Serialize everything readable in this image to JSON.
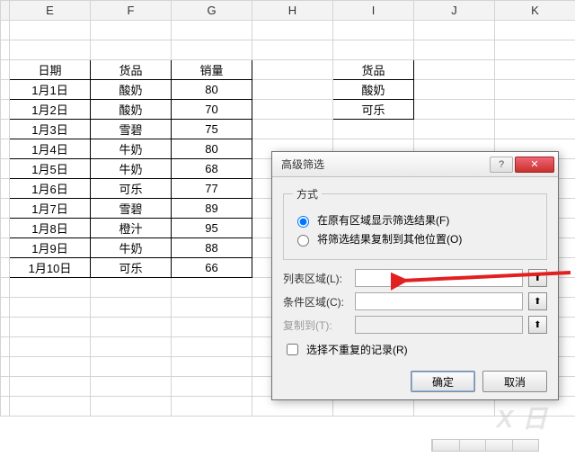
{
  "columns": [
    "E",
    "F",
    "G",
    "H",
    "I",
    "J",
    "K"
  ],
  "table1": {
    "headers": [
      "日期",
      "货品",
      "销量"
    ],
    "rows": [
      [
        "1月1日",
        "酸奶",
        "80"
      ],
      [
        "1月2日",
        "酸奶",
        "70"
      ],
      [
        "1月3日",
        "雪碧",
        "75"
      ],
      [
        "1月4日",
        "牛奶",
        "80"
      ],
      [
        "1月5日",
        "牛奶",
        "68"
      ],
      [
        "1月6日",
        "可乐",
        "77"
      ],
      [
        "1月7日",
        "雪碧",
        "89"
      ],
      [
        "1月8日",
        "橙汁",
        "95"
      ],
      [
        "1月9日",
        "牛奶",
        "88"
      ],
      [
        "1月10日",
        "可乐",
        "66"
      ]
    ]
  },
  "table2": {
    "header": "货品",
    "rows": [
      "酸奶",
      "可乐"
    ]
  },
  "dialog": {
    "title": "高级筛选",
    "method_legend": "方式",
    "radio_inplace": "在原有区域显示筛选结果(F)",
    "radio_copy": "将筛选结果复制到其他位置(O)",
    "list_label": "列表区域(L):",
    "list_value": "",
    "criteria_label": "条件区域(C):",
    "criteria_value": "",
    "copyto_label": "复制到(T):",
    "copyto_value": "",
    "unique_label": "选择不重复的记录(R)",
    "ok": "确定",
    "cancel": "取消",
    "help_icon": "?",
    "close_icon": "✕",
    "picker_icon": "⬆"
  },
  "watermark": "X 日"
}
